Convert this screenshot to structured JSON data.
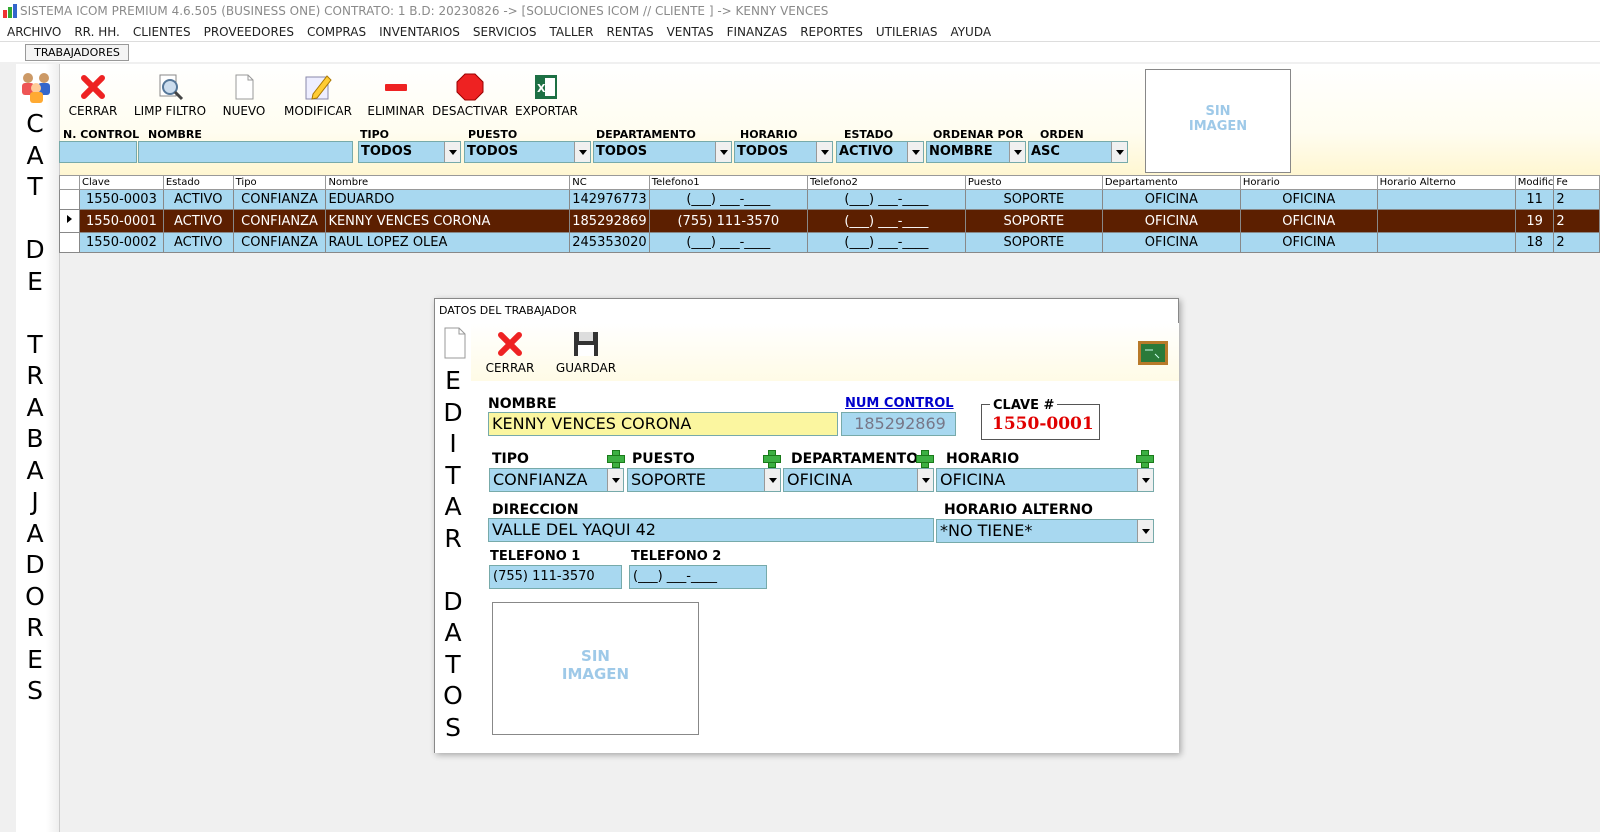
{
  "window": {
    "title": "SISTEMA ICOM PREMIUM 4.6.505 (BUSINESS ONE)   CONTRATO: 1   B.D: 20230826   ->   [SOLUCIONES ICOM // CLIENTE ]   ->   KENNY VENCES"
  },
  "menu": [
    "ARCHIVO",
    "RR. HH.",
    "CLIENTES",
    "PROVEEDORES",
    "COMPRAS",
    "INVENTARIOS",
    "SERVICIOS",
    "TALLER",
    "RENTAS",
    "VENTAS",
    "FINANZAS",
    "REPORTES",
    "UTILERIAS",
    "AYUDA"
  ],
  "tab": {
    "label": "TRABAJADORES"
  },
  "side_title": "C\nA\nT\n\nD\nE\n\nT\nR\nA\nB\nA\nJ\nA\nD\nO\nR\nE\nS",
  "toolbar": {
    "cerrar": "CERRAR",
    "limp_filtro": "LIMP FILTRO",
    "nuevo": "NUEVO",
    "modificar": "MODIFICAR",
    "eliminar": "ELIMINAR",
    "desactivar": "DESACTIVAR",
    "exportar": "EXPORTAR"
  },
  "filters": {
    "labels": {
      "n_control": "N. CONTROL",
      "nombre": "NOMBRE",
      "tipo": "TIPO",
      "puesto": "PUESTO",
      "departamento": "DEPARTAMENTO",
      "horario": "HORARIO",
      "estado": "ESTADO",
      "ordenar_por": "ORDENAR POR",
      "orden": "ORDEN"
    },
    "values": {
      "tipo": "TODOS",
      "puesto": "TODOS",
      "departamento": "TODOS",
      "horario": "TODOS",
      "estado": "ACTIVO",
      "ordenar_por": "NOMBRE",
      "orden": "ASC"
    }
  },
  "no_image": {
    "line1": "SIN",
    "line2": "IMAGEN"
  },
  "grid": {
    "columns": [
      "Clave",
      "Estado",
      "Tipo",
      "Nombre",
      "NC",
      "Telefono1",
      "Telefono2",
      "Puesto",
      "Departamento",
      "Horario",
      "Horario Alterno",
      "Modific",
      "Fe"
    ],
    "rows": [
      {
        "clave": "1550-0003",
        "estado": "ACTIVO",
        "tipo": "CONFIANZA",
        "nombre": "EDUARDO",
        "nc": "142976773",
        "tel1": "(___) ___-____",
        "tel2": "(___) ___-____",
        "puesto": "SOPORTE",
        "depto": "OFICINA",
        "horario": "OFICINA",
        "alterno": "",
        "modific": "11",
        "fe": "2"
      },
      {
        "clave": "1550-0001",
        "estado": "ACTIVO",
        "tipo": "CONFIANZA",
        "nombre": "KENNY VENCES CORONA",
        "nc": "185292869",
        "tel1": "(755) 111-3570",
        "tel2": "(___) ___-____",
        "puesto": "SOPORTE",
        "depto": "OFICINA",
        "horario": "OFICINA",
        "alterno": "",
        "modific": "19",
        "fe": "2"
      },
      {
        "clave": "1550-0002",
        "estado": "ACTIVO",
        "tipo": "CONFIANZA",
        "nombre": "RAUL LOPEZ OLEA",
        "nc": "245353020",
        "tel1": "(___) ___-____",
        "tel2": "(___) ___-____",
        "puesto": "SOPORTE",
        "depto": "OFICINA",
        "horario": "OFICINA",
        "alterno": "",
        "modific": "18",
        "fe": "2"
      }
    ]
  },
  "dialog": {
    "title": "DATOS DEL TRABAJADOR",
    "side_title": "E\nD\nI\nT\nA\nR\n\nD\nA\nT\nO\nS",
    "cerrar": "CERRAR",
    "guardar": "GUARDAR",
    "nombre_label": "NOMBRE",
    "nombre_value": "KENNY VENCES CORONA",
    "num_control_label": "NUM CONTROL",
    "num_control_value": "185292869",
    "clave_label": "CLAVE #",
    "clave_value": "1550-0001",
    "tipo_label": "TIPO",
    "tipo_value": "CONFIANZA",
    "puesto_label": "PUESTO",
    "puesto_value": "SOPORTE",
    "departamento_label": "DEPARTAMENTO",
    "departamento_value": "OFICINA",
    "horario_label": "HORARIO",
    "horario_value": "OFICINA",
    "direccion_label": "DIRECCION",
    "direccion_value": "VALLE DEL YAQUI 42",
    "horario_alterno_label": "HORARIO ALTERNO",
    "horario_alterno_value": "*NO TIENE*",
    "telefono1_label": "TELEFONO 1",
    "telefono1_value": "(755) 111-3570",
    "telefono2_label": "TELEFONO 2",
    "telefono2_value": "(___) ___-____"
  }
}
